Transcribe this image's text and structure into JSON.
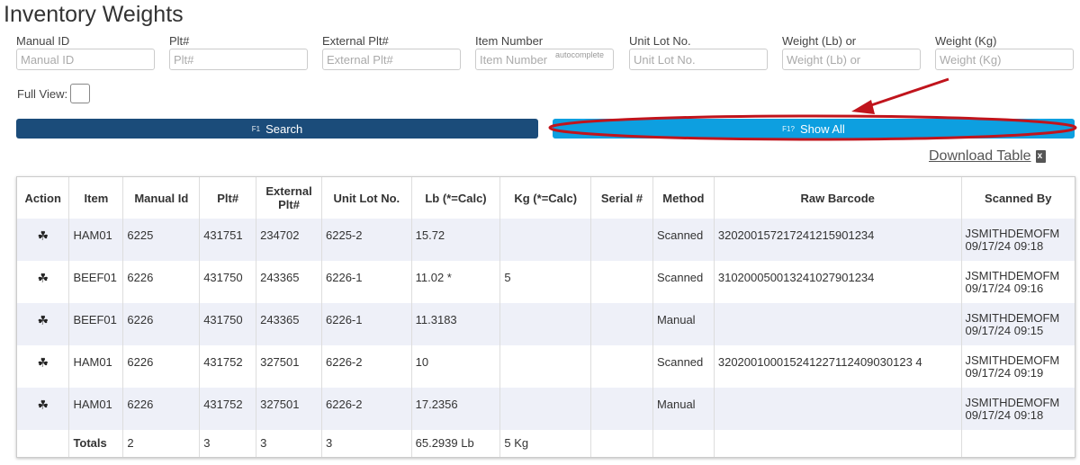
{
  "page": {
    "title": "Inventory Weights"
  },
  "filters": [
    {
      "label": "Manual ID",
      "placeholder": "Manual ID"
    },
    {
      "label": "Plt#",
      "placeholder": "Plt#"
    },
    {
      "label": "External Plt#",
      "placeholder": "External Plt#"
    },
    {
      "label": "Item Number",
      "placeholder": "Item Number",
      "badge": "autocomplete"
    },
    {
      "label": "Unit Lot No.",
      "placeholder": "Unit Lot No."
    },
    {
      "label": "Weight (Lb) or",
      "placeholder": "Weight (Lb) or"
    },
    {
      "label": "Weight (Kg)",
      "placeholder": "Weight (Kg)"
    }
  ],
  "full_view": {
    "label": "Full View:"
  },
  "buttons": {
    "search": {
      "key": "F1",
      "label": "Search"
    },
    "show_all": {
      "key": "F1?",
      "label": "Show All"
    }
  },
  "download": {
    "label": "Download Table",
    "icon": "excel-file-icon"
  },
  "table": {
    "headers": [
      "Action",
      "Item",
      "Manual Id",
      "Plt#",
      "External Plt#",
      "Unit Lot No.",
      "Lb (*=Calc)",
      "Kg (*=Calc)",
      "Serial #",
      "Method",
      "Raw Barcode",
      "Scanned By"
    ],
    "rows": [
      {
        "action": "☘",
        "item": "HAM01",
        "manual_id": "6225",
        "plt": "431751",
        "ext_plt": "234702",
        "lot": "6225-2",
        "lb": "15.72",
        "kg": "",
        "serial": "",
        "method": "Scanned",
        "barcode": "320200157217241215901234",
        "user": "JSMITHDEMOFM",
        "time": "09/17/24 09:18"
      },
      {
        "action": "☘",
        "item": "BEEF01",
        "manual_id": "6226",
        "plt": "431750",
        "ext_plt": "243365",
        "lot": "6226-1",
        "lb": "11.02 *",
        "kg": "5",
        "serial": "",
        "method": "Scanned",
        "barcode": "310200050013241027901234",
        "user": "JSMITHDEMOFM",
        "time": "09/17/24 09:16"
      },
      {
        "action": "☘",
        "item": "BEEF01",
        "manual_id": "6226",
        "plt": "431750",
        "ext_plt": "243365",
        "lot": "6226-1",
        "lb": "11.3183",
        "kg": "",
        "serial": "",
        "method": "Manual",
        "barcode": "",
        "user": "JSMITHDEMOFM",
        "time": "09/17/24 09:15"
      },
      {
        "action": "☘",
        "item": "HAM01",
        "manual_id": "6226",
        "plt": "431752",
        "ext_plt": "327501",
        "lot": "6226-2",
        "lb": "10",
        "kg": "",
        "serial": "",
        "method": "Scanned",
        "barcode": "320200100015241227112409030123 4",
        "user": "JSMITHDEMOFM",
        "time": "09/17/24 09:19"
      },
      {
        "action": "☘",
        "item": "HAM01",
        "manual_id": "6226",
        "plt": "431752",
        "ext_plt": "327501",
        "lot": "6226-2",
        "lb": "17.2356",
        "kg": "",
        "serial": "",
        "method": "Manual",
        "barcode": "",
        "user": "JSMITHDEMOFM",
        "time": "09/17/24 09:18"
      }
    ],
    "totals": {
      "label": "Totals",
      "manual_id": "2",
      "plt": "3",
      "ext_plt": "3",
      "lot": "3",
      "lb": "65.2939 Lb",
      "kg": "5 Kg"
    }
  },
  "colors": {
    "search_button": "#1b4c7a",
    "show_all_button": "#0d9fe0",
    "annotation": "#c0141c",
    "row_stripe": "#eef0f8"
  }
}
